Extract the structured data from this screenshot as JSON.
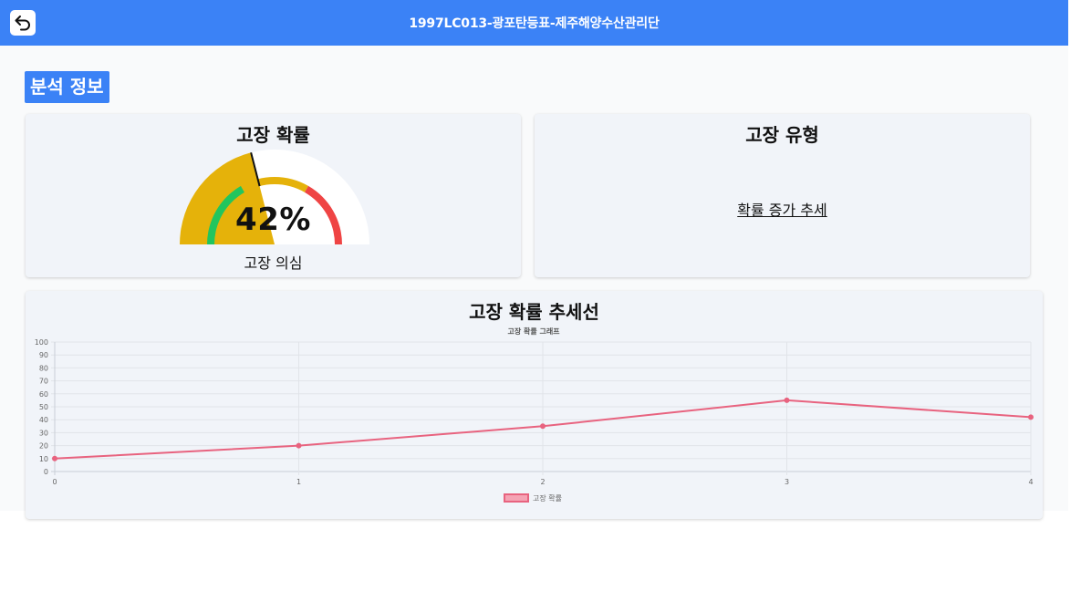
{
  "header": {
    "title": "1997LC013-광포탄등표-제주해양수산관리단",
    "back_icon": "back-arrow-icon"
  },
  "section": {
    "title": "분석 정보"
  },
  "failure_probability": {
    "title": "고장 확률",
    "value": 42,
    "value_text": "42%",
    "status": "고장 의심"
  },
  "failure_type": {
    "title": "고장 유형",
    "value": "확률 증가 추세"
  },
  "trend": {
    "title": "고장 확률 추세선"
  },
  "colors": {
    "accent": "#3b82f6",
    "gauge_yellow": "#e5b20a",
    "gauge_green": "#22c55e",
    "gauge_red": "#ef4444",
    "line": "#e8637f"
  },
  "chart_data": {
    "type": "line",
    "title": "고장 확률 그래프",
    "x": [
      0,
      1,
      2,
      3,
      4
    ],
    "x_tick_labels": [
      "0",
      "1",
      "2",
      "3",
      "4"
    ],
    "series": [
      {
        "name": "고장 확률",
        "values": [
          10,
          20,
          35,
          55,
          42
        ]
      }
    ],
    "ylim": [
      0,
      100
    ],
    "y_ticks": [
      0,
      10,
      20,
      30,
      40,
      50,
      60,
      70,
      80,
      90,
      100
    ],
    "y_tick_labels": [
      "0",
      "10",
      "20",
      "30",
      "40",
      "50",
      "60",
      "70",
      "80",
      "90",
      "100"
    ],
    "grid": true,
    "legend": "bottom"
  }
}
